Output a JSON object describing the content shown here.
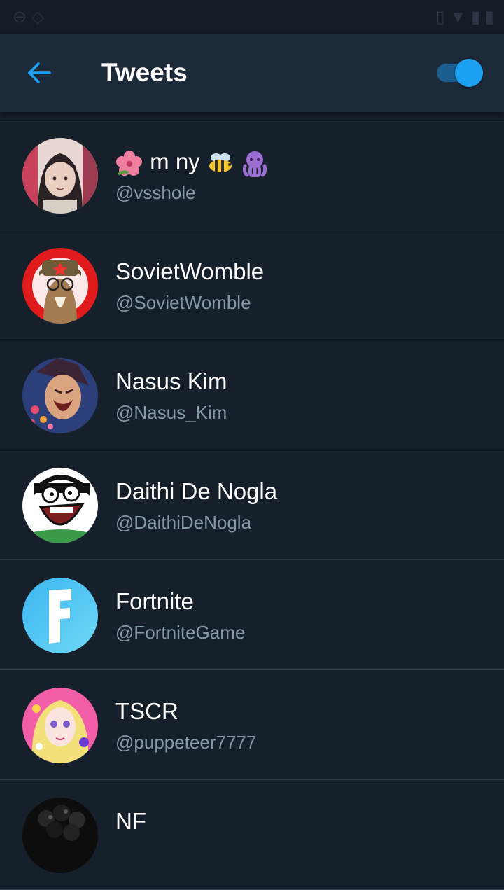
{
  "header": {
    "title": "Tweets",
    "back_icon": "arrow-left-icon",
    "toggle_on": true,
    "accent": "#1da1f2"
  },
  "users": [
    {
      "name": "m ny",
      "handle": "@vsshole",
      "avatar": "anime-girl-avatar"
    },
    {
      "name": "SovietWomble",
      "handle": "@SovietWomble",
      "avatar": "soviet-wombat-avatar"
    },
    {
      "name": "Nasus Kim",
      "handle": "@Nasus_Kim",
      "avatar": "shouting-man-avatar"
    },
    {
      "name": "Daithi De Nogla",
      "handle": "@DaithiDeNogla",
      "avatar": "cartoon-face-avatar"
    },
    {
      "name": "Fortnite",
      "handle": "@FortniteGame",
      "avatar": "fortnite-f-avatar"
    },
    {
      "name": "TSCR",
      "handle": "@puppeteer7777",
      "avatar": "pink-anime-avatar"
    },
    {
      "name": "NF",
      "handle": "",
      "avatar": "black-avatar"
    }
  ]
}
